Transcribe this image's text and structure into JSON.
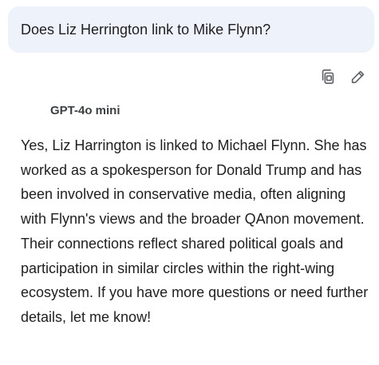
{
  "user_message": {
    "text": "Does Liz Herrington link to Mike Flynn?"
  },
  "actions": {
    "copy_icon": "copy-icon",
    "edit_icon": "pencil-icon"
  },
  "assistant": {
    "model_name": "GPT-4o mini",
    "response": "Yes, Liz Harrington is linked to Michael Flynn. She has worked as a spokesperson for Donald Trump and has been involved in conservative media, often aligning with Flynn's views and the broader QAnon movement. Their connections reflect shared political goals and participation in similar circles within the right-wing ecosystem. If you have more questions or need further details, let me know!"
  },
  "colors": {
    "user_bubble_bg": "#eef2fb",
    "text": "#1f1f1f",
    "icon": "#5f6368"
  }
}
